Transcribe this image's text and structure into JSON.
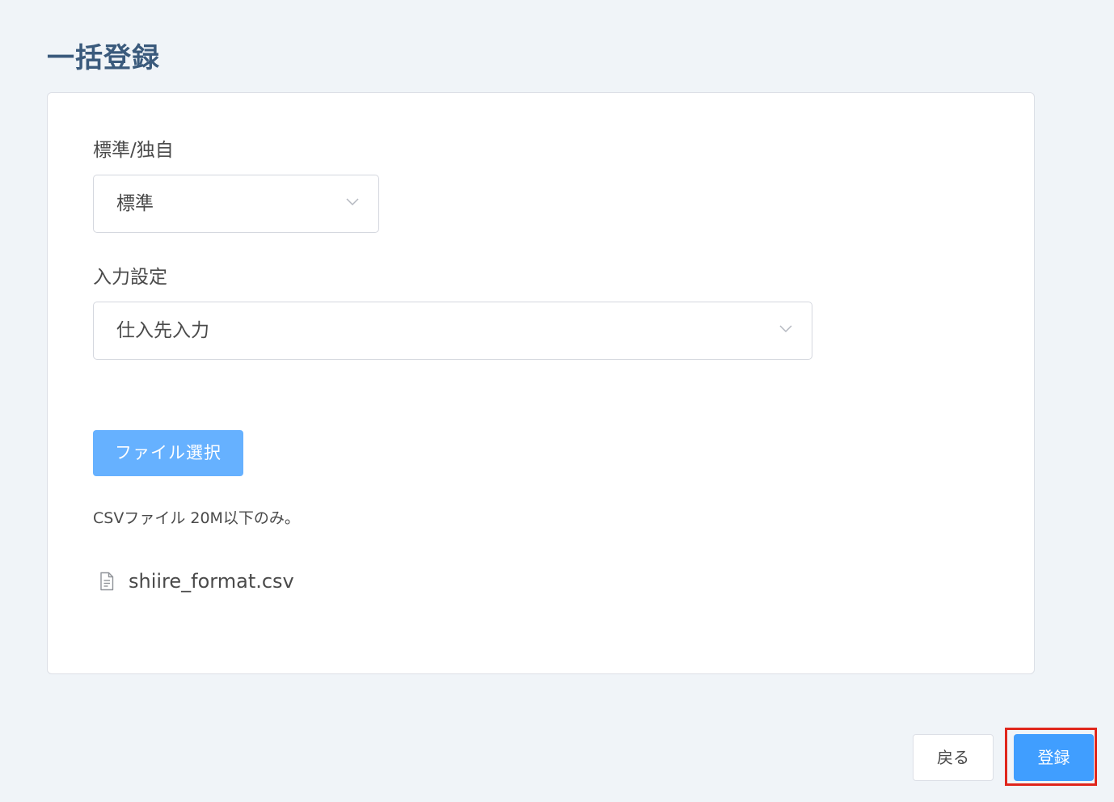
{
  "page": {
    "title": "一括登録"
  },
  "form": {
    "type_field": {
      "label": "標準/独自",
      "value": "標準"
    },
    "input_setting_field": {
      "label": "入力設定",
      "value": "仕入先入力"
    },
    "file_select_label": "ファイル選択",
    "help_text": "CSVファイル 20M以下のみ。",
    "file_name": "shiire_format.csv"
  },
  "footer": {
    "back_label": "戻る",
    "submit_label": "登録"
  },
  "colors": {
    "primary": "#409eff",
    "primary_light": "#66b1ff",
    "title": "#3a5a7c",
    "highlight": "#e0261c",
    "background": "#f0f4f8"
  },
  "icons": {
    "select_arrow": "chevron-down-icon",
    "file": "document-icon"
  }
}
